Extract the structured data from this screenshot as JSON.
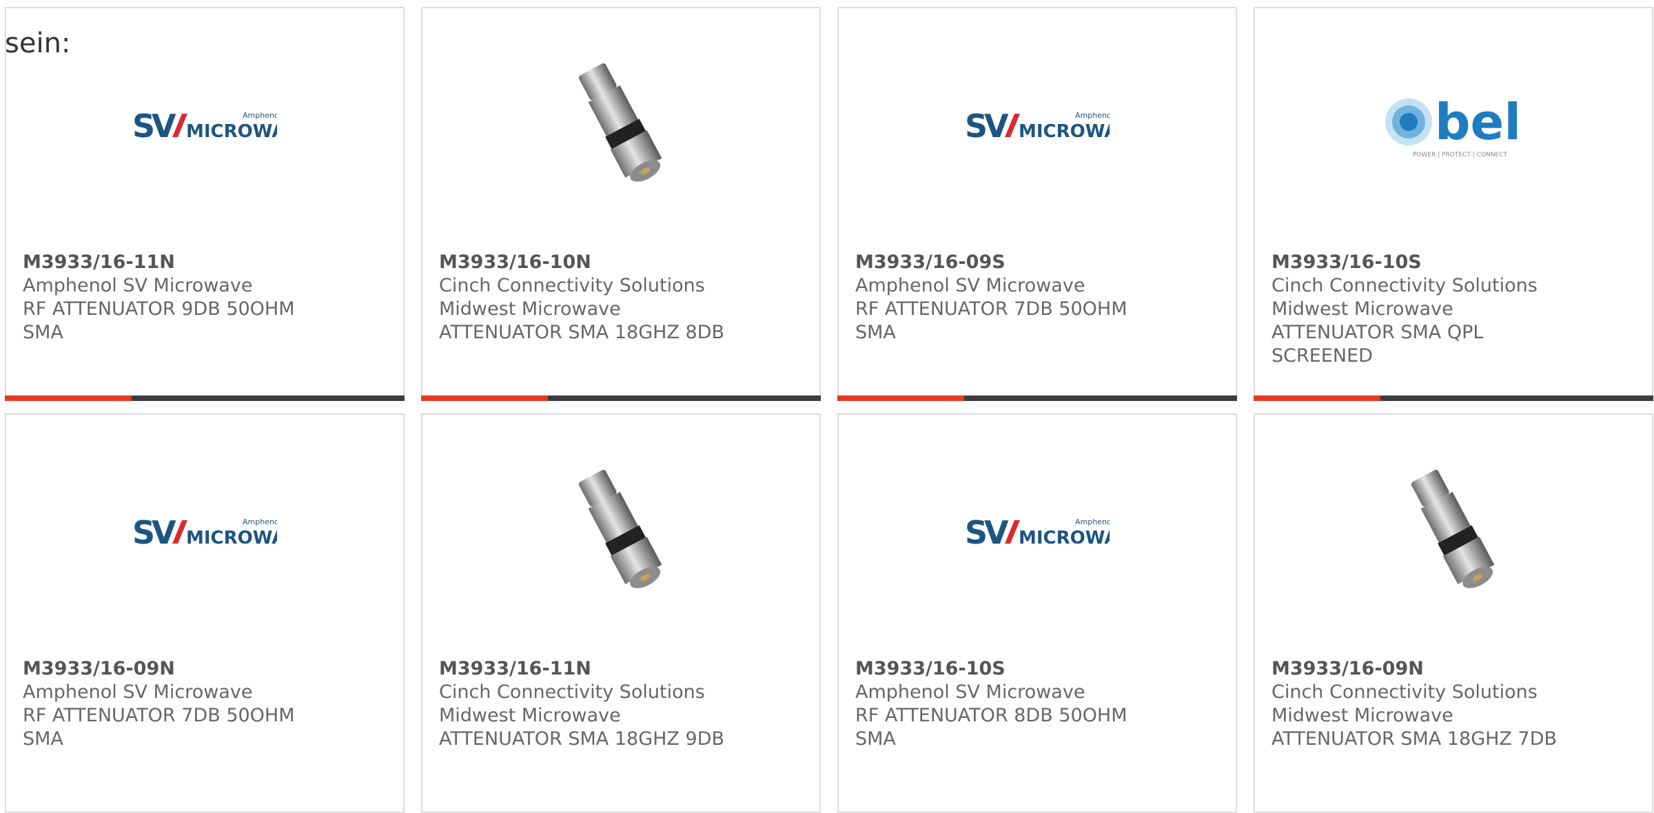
{
  "intro_text": "sein:",
  "colors": {
    "accent": "#e8391f",
    "bar": "#3d3d3d",
    "sv_blue": "#1c5582",
    "sv_red": "#d92b2f",
    "bel_blue": "#1f7cc1"
  },
  "products": [
    {
      "part": "M3933/16-11N",
      "line1": "Amphenol SV Microwave",
      "line2": "RF ATTENUATOR 9DB 50OHM",
      "line3": "SMA",
      "line4": "",
      "image": "sv-microwave-logo",
      "logo_small": "Amphenol",
      "logo_text": "MICROWAVE"
    },
    {
      "part": "M3933/16-10N",
      "line1": "Cinch Connectivity Solutions",
      "line2": "Midwest Microwave",
      "line3": "ATTENUATOR SMA 18GHZ 8DB",
      "line4": "",
      "image": "sma-attenuator-photo"
    },
    {
      "part": "M3933/16-09S",
      "line1": "Amphenol SV Microwave",
      "line2": "RF ATTENUATOR 7DB 50OHM",
      "line3": "SMA",
      "line4": "",
      "image": "sv-microwave-logo",
      "logo_small": "Amphenol",
      "logo_text": "MICROWAVE"
    },
    {
      "part": "M3933/16-10S",
      "line1": "Cinch Connectivity Solutions",
      "line2": "Midwest Microwave",
      "line3": "ATTENUATOR SMA QPL",
      "line4": "SCREENED",
      "image": "bel-logo",
      "logo_text": "bel",
      "logo_tagline": "POWER | PROTECT | CONNECT"
    },
    {
      "part": "M3933/16-09N",
      "line1": "Amphenol SV Microwave",
      "line2": "RF ATTENUATOR 7DB 50OHM",
      "line3": "SMA",
      "line4": "",
      "image": "sv-microwave-logo",
      "logo_small": "Amphenol",
      "logo_text": "MICROWAVE"
    },
    {
      "part": "M3933/16-11N",
      "line1": "Cinch Connectivity Solutions",
      "line2": "Midwest Microwave",
      "line3": "ATTENUATOR SMA 18GHZ 9DB",
      "line4": "",
      "image": "sma-attenuator-photo"
    },
    {
      "part": "M3933/16-10S",
      "line1": "Amphenol SV Microwave",
      "line2": "RF ATTENUATOR 8DB 50OHM",
      "line3": "SMA",
      "line4": "",
      "image": "sv-microwave-logo",
      "logo_small": "Amphenol",
      "logo_text": "MICROWAVE"
    },
    {
      "part": "M3933/16-09N",
      "line1": "Cinch Connectivity Solutions",
      "line2": "Midwest Microwave",
      "line3": "ATTENUATOR SMA 18GHZ 7DB",
      "line4": "",
      "image": "sma-attenuator-photo"
    }
  ]
}
